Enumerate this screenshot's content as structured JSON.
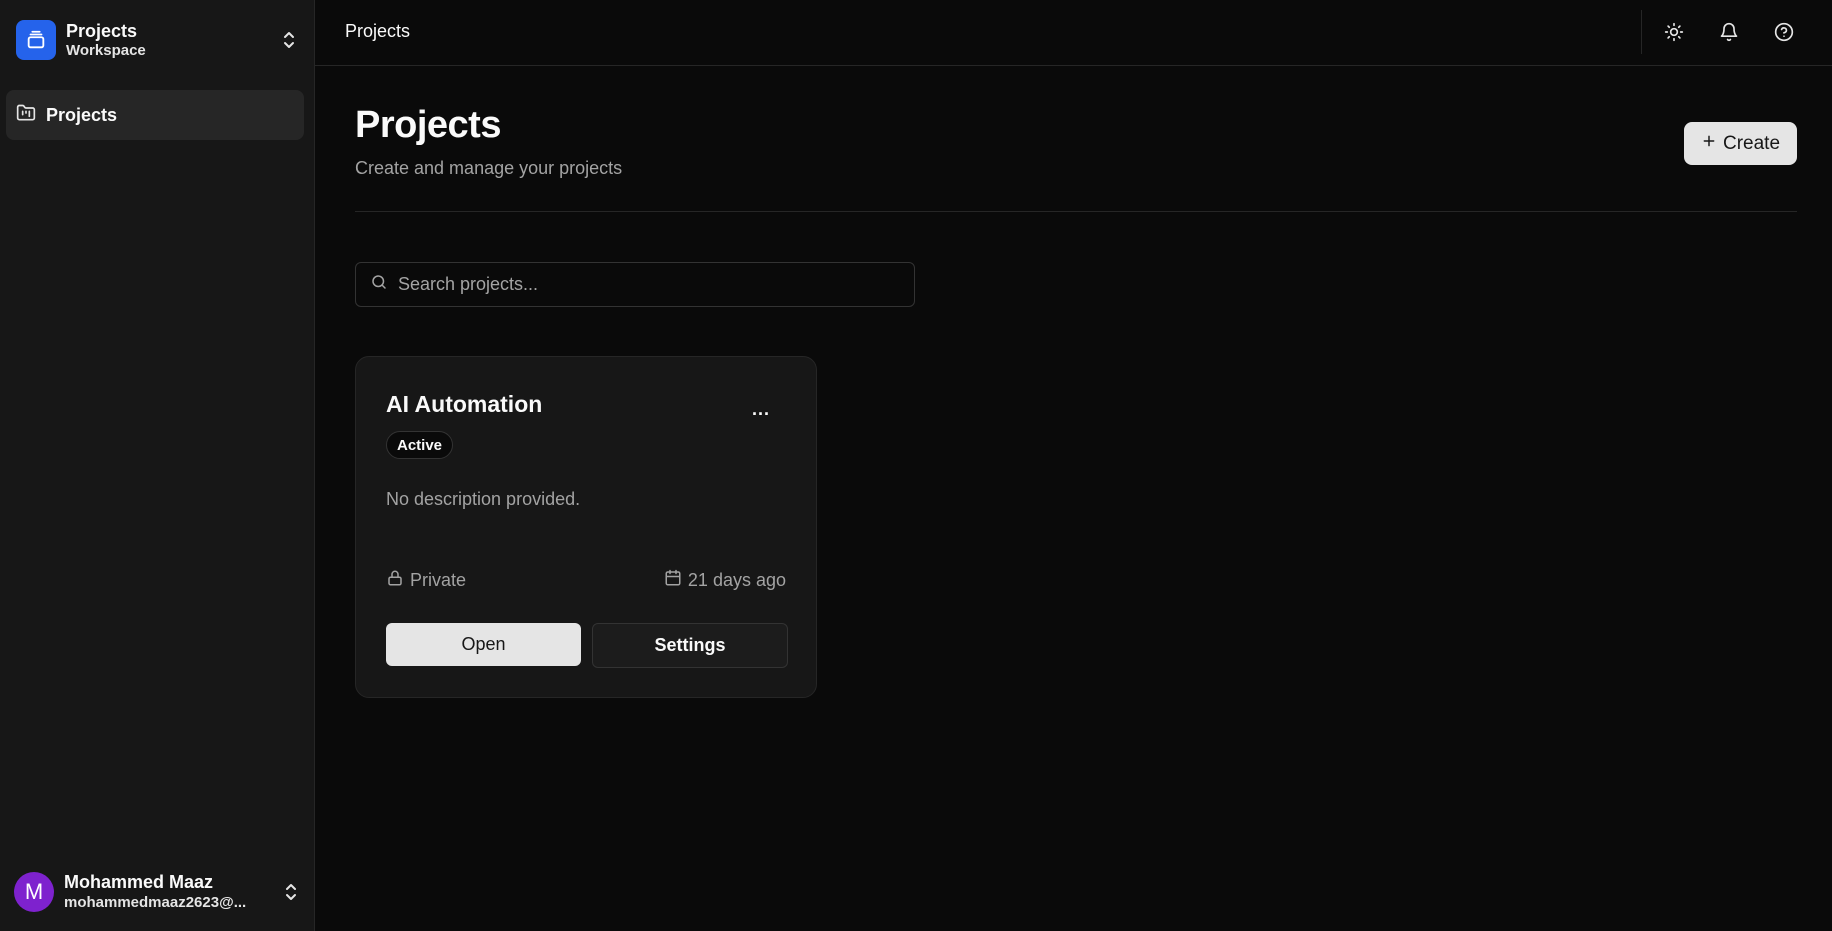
{
  "sidebar": {
    "workspace": {
      "title": "Projects",
      "subtitle": "Workspace"
    },
    "nav": [
      {
        "label": "Projects",
        "icon": "folder-kanban-icon",
        "active": true
      }
    ],
    "user": {
      "avatar_initial": "M",
      "name": "Mohammed Maaz",
      "email": "mohammedmaaz2623@..."
    }
  },
  "topbar": {
    "title": "Projects",
    "icons": [
      "sun-icon",
      "bell-icon",
      "help-circle-icon"
    ]
  },
  "main": {
    "title": "Projects",
    "subtitle": "Create and manage your projects",
    "create_label": "Create",
    "search": {
      "placeholder": "Search projects...",
      "value": ""
    },
    "projects": [
      {
        "name": "AI Automation",
        "status": "Active",
        "description": "No description provided.",
        "visibility": "Private",
        "updated": "21 days ago",
        "open_label": "Open",
        "settings_label": "Settings",
        "more_label": "..."
      }
    ]
  },
  "colors": {
    "background": "#0a0a0a",
    "sidebar": "#171717",
    "accent_blue": "#2563eb",
    "avatar_purple": "#7e22ce"
  }
}
